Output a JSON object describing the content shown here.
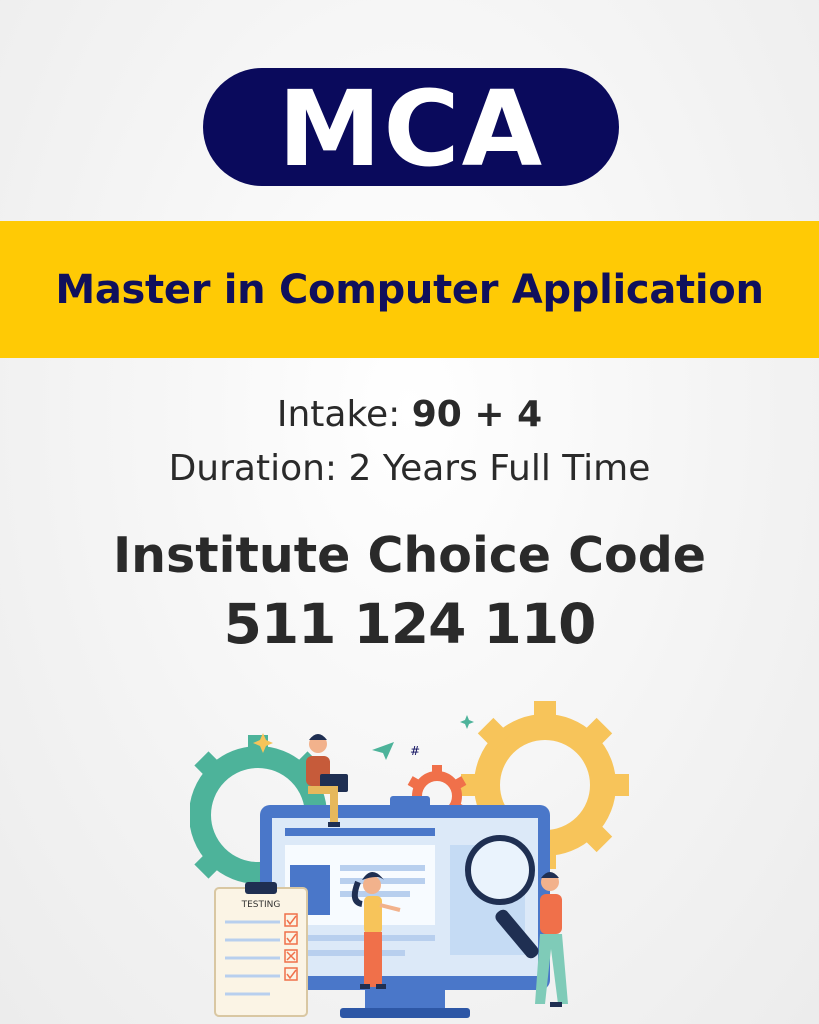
{
  "logo": {
    "text": "MCA"
  },
  "banner": {
    "title": "Master in Computer Application"
  },
  "details": {
    "intake_label": "Intake:",
    "intake_value": "90 + 4",
    "duration_label": "Duration:",
    "duration_value": "2 Years Full Time"
  },
  "institute": {
    "title": "Institute Choice Code",
    "code": "511 124 110"
  },
  "illustration": {
    "clipboard_label": "TESTING",
    "colors": {
      "navy": "#0a0a5c",
      "yellow": "#ffca05",
      "gear_teal": "#4db39a",
      "gear_yellow": "#f7c45a",
      "gear_orange": "#f0704a",
      "monitor_blue": "#4a77c9",
      "screen_light": "#dce9f8"
    }
  }
}
